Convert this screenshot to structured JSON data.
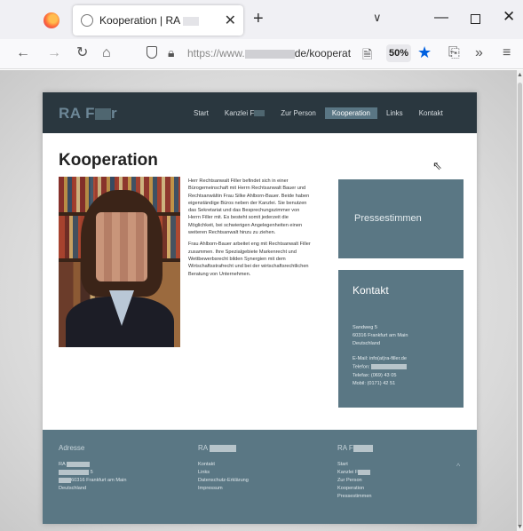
{
  "browser": {
    "tab_title": "Kooperation | RA",
    "new_tab": "+",
    "tab_close": "✕",
    "url_prefix": "https://www.",
    "url_suffix": "de/kooperatio",
    "zoom": "50%",
    "icons": [
      "firefox-logo",
      "back-icon",
      "forward-icon",
      "reload-icon",
      "home-icon",
      "shield-icon",
      "lock-icon",
      "reader-icon",
      "star-icon",
      "extensions-icon",
      "overflow-icon",
      "menu-icon"
    ]
  },
  "site": {
    "logo": "RA F",
    "logo_tail": "r",
    "nav": [
      {
        "label": "Start"
      },
      {
        "label": "Kanzlei F"
      },
      {
        "label": "Zur Person"
      },
      {
        "label": "Kooperation",
        "active": true
      },
      {
        "label": "Links"
      },
      {
        "label": "Kontakt"
      }
    ],
    "page_title": "Kooperation",
    "paragraph_1": "Herr Rechtsanwalt Filler befindet sich in einer Bürogemeinschaft mit Herrn Rechtsanwalt Bauer und Rechtsanwältin Frau Silke Ahlborn-Bauer. Beide haben eigenständige Büros neben der Kanzlei. Sie benutzen das Sekretariat und das Besprechungszimmer von Herrn Filler mit. Es besteht somit jederzeit die Möglichkeit, bei schwierigen Angelegenheiten einen weiteren Rechtsanwalt hinzu zu ziehen.",
    "paragraph_2": "Frau Ahlborn-Bauer arbeitet eng mit Rechtsanwalt Filler zusammen. Ihre Spezialgebiete Markenrecht und Wettbewerbsrecht bilden Synergien mit dem Wirtschaftsstrafrecht und bei der wirtschaftsrechtlichen Beratung von Unternehmen.",
    "press_box": "Pressestimmen",
    "contact": {
      "heading": "Kontakt",
      "street": "Sandweg 5",
      "city": "60316 Frankfurt am Main",
      "country": "Deutschland",
      "email": "E-Mail: info(at)ra-filler.de",
      "phone_label": "Telefon:",
      "fax": "Telefax: (069) 43 05",
      "mobile": "Mobil: (0171) 42 51"
    },
    "footer": {
      "col1": {
        "heading": "Adresse",
        "lines": [
          "RA",
          "5",
          "60316 Frankfurt am Main",
          "Deutschland"
        ]
      },
      "col2": {
        "heading": "RA",
        "lines": [
          "Kontakt",
          "Links",
          "Datenschutz-Erklärung",
          "Impressum"
        ]
      },
      "col3": {
        "heading": "RA F",
        "lines": [
          "Start",
          "Kanzlei F",
          "Zur Person",
          "Kooperation",
          "Pressestimmen"
        ]
      },
      "to_top": "^"
    }
  },
  "colors": {
    "header_bg": "#2a373f",
    "accent": "#5a7784",
    "active_nav": "#5a7684",
    "star": "#0060df"
  }
}
